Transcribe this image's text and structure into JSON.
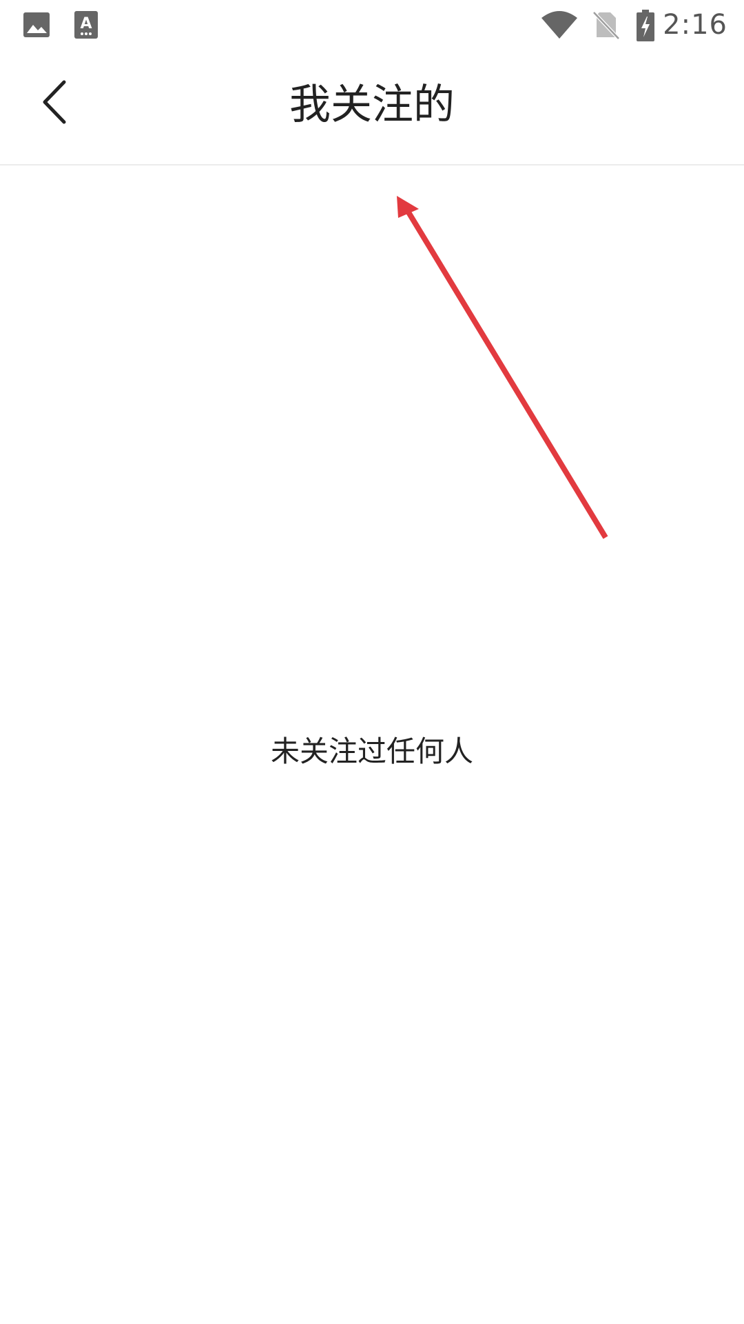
{
  "status_bar": {
    "time": "2:16",
    "left_icons": [
      "image-icon",
      "text-app-icon"
    ],
    "right_icons": [
      "wifi-icon",
      "no-sim-icon",
      "battery-charging-icon"
    ]
  },
  "toolbar": {
    "back_icon": "chevron-left-icon",
    "title": "我关注的"
  },
  "content": {
    "empty_message": "未关注过任何人"
  },
  "annotation": {
    "arrow_color": "#e23a3f"
  },
  "colors": {
    "title_text": "#222222",
    "status_icons": "#666666",
    "divider": "#ececec",
    "background": "#ffffff"
  }
}
